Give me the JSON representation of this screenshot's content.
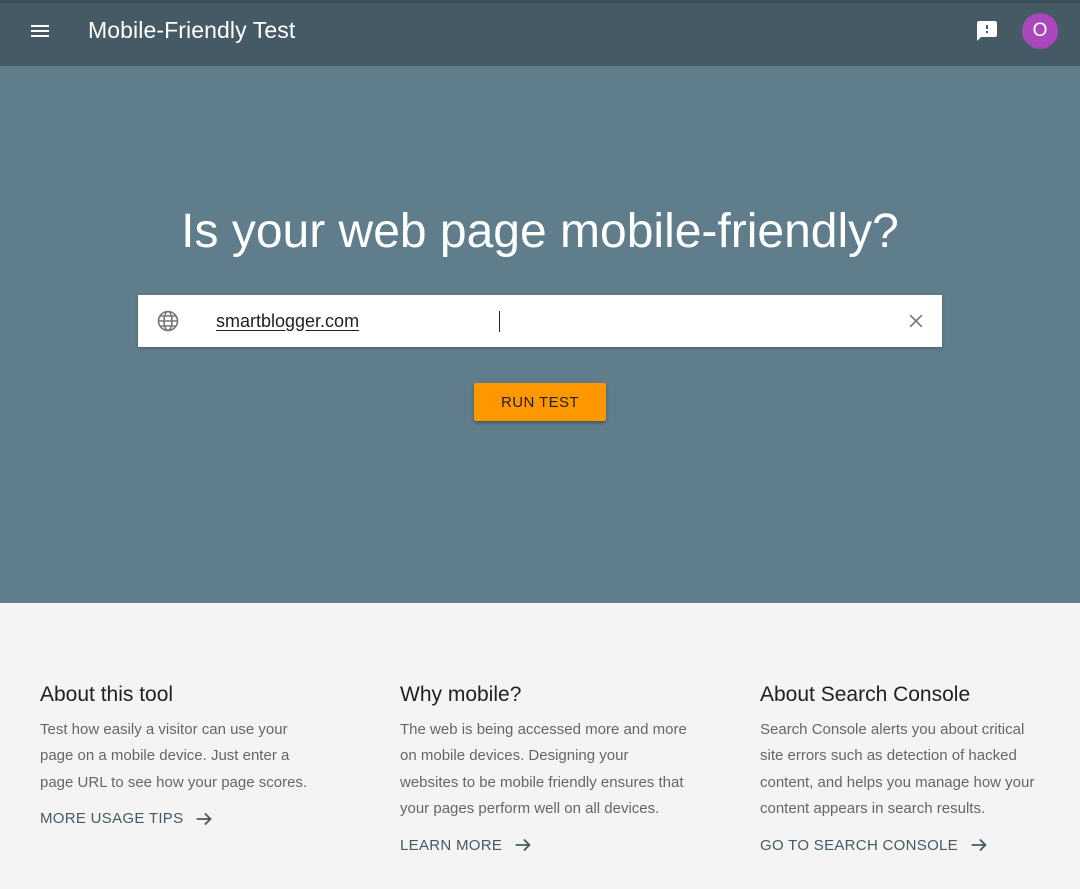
{
  "header": {
    "title": "Mobile-Friendly Test",
    "avatar_letter": "O",
    "avatar_color": "#ab47bc",
    "bar_color": "#455a64"
  },
  "hero": {
    "title": "Is your web page mobile-friendly?",
    "url_value": "smartblogger.com",
    "run_button": "RUN TEST",
    "button_color": "#ff9800",
    "background_color": "#607d8b"
  },
  "info": [
    {
      "heading": "About this tool",
      "body": "Test how easily a visitor can use your page on a mobile device. Just enter a page URL to see how your page scores.",
      "link": "MORE USAGE TIPS"
    },
    {
      "heading": "Why mobile?",
      "body": "The web is being accessed more and more on mobile devices. Designing your websites to be mobile friendly ensures that your pages perform well on all devices.",
      "link": "LEARN MORE"
    },
    {
      "heading": "About Search Console",
      "body": "Search Console alerts you about critical site errors such as detection of hacked content, and helps you manage how your content appears in search results.",
      "link": "GO TO SEARCH CONSOLE"
    }
  ],
  "icons": {
    "menu": "menu-icon",
    "feedback": "feedback-icon",
    "globe": "globe-icon",
    "clear": "close-icon",
    "arrow": "arrow-right-icon"
  }
}
